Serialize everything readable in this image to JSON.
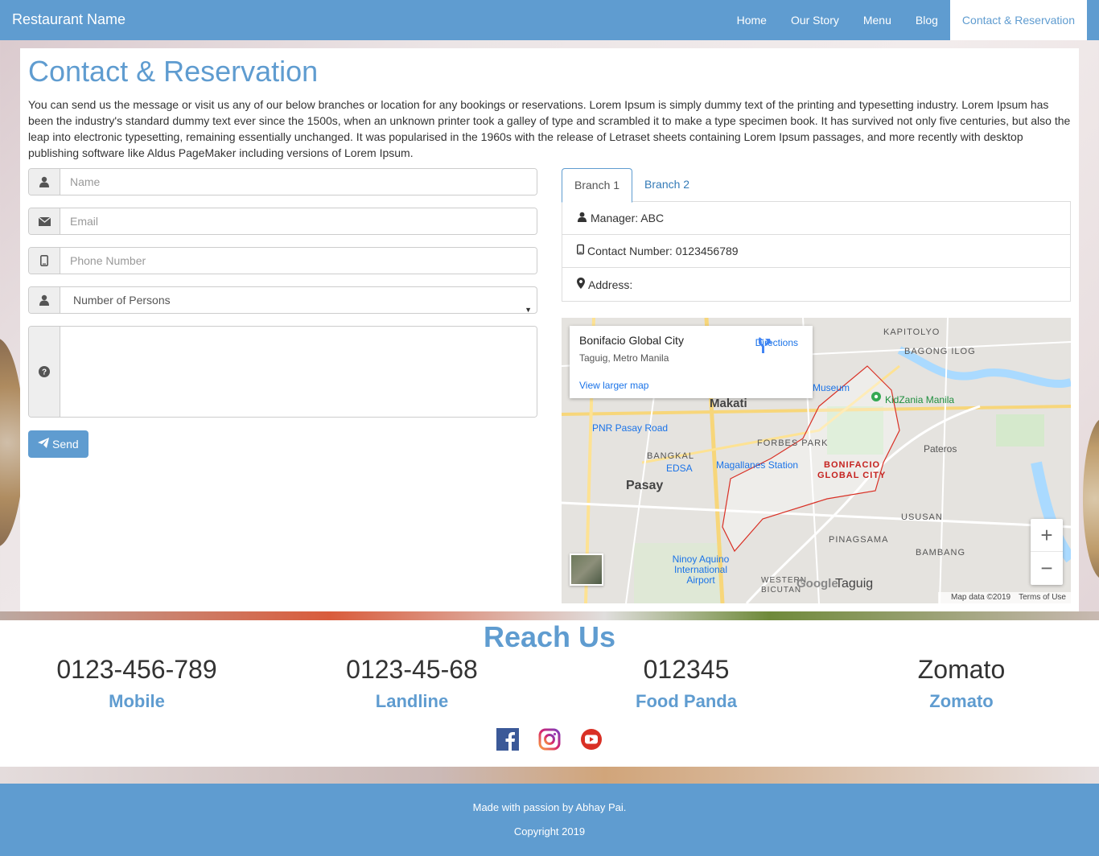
{
  "navbar": {
    "brand": "Restaurant Name",
    "items": [
      {
        "label": "Home"
      },
      {
        "label": "Our Story"
      },
      {
        "label": "Menu"
      },
      {
        "label": "Blog"
      },
      {
        "label": "Contact & Reservation",
        "active": true
      }
    ]
  },
  "contact": {
    "title": "Contact & Reservation",
    "intro": "You can send us the message or visit us any of our below branches or location for any bookings or reservations. Lorem Ipsum is simply dummy text of the printing and typesetting industry. Lorem Ipsum has been the industry's standard dummy text ever since the 1500s, when an unknown printer took a galley of type and scrambled it to make a type specimen book. It has survived not only five centuries, but also the leap into electronic typesetting, remaining essentially unchanged. It was popularised in the 1960s with the release of Letraset sheets containing Lorem Ipsum passages, and more recently with desktop publishing software like Aldus PageMaker including versions of Lorem Ipsum."
  },
  "form": {
    "name_placeholder": "Name",
    "email_placeholder": "Email",
    "phone_placeholder": "Phone Number",
    "persons_selected": "Number of Persons",
    "message_value": "",
    "send_label": "Send"
  },
  "branches": {
    "tabs": [
      {
        "label": "Branch 1",
        "active": true
      },
      {
        "label": "Branch 2"
      }
    ],
    "manager": "Manager: ABC",
    "contact": "Contact Number: 0123456789",
    "address": "Address:"
  },
  "map": {
    "place": "Bonifacio Global City",
    "subtitle": "Taguig, Metro Manila",
    "directions": "Directions",
    "larger_map": "View larger map",
    "attribution": "Map data ©2019",
    "terms": "Terms of Use",
    "labels": {
      "makati": "Makati",
      "pasay": "Pasay",
      "bgc": "BONIFACIO",
      "bgc2": "GLOBAL CITY",
      "kidzania": "KidZania Manila",
      "forbes": "FORBES PARK",
      "bangkal": "BANGKAL",
      "edsa": "EDSA",
      "magallanes": "Magallanes Station",
      "pnr": "PNR Pasay Road",
      "pateros": "Pateros",
      "ususan": "USUSAN",
      "pinagsama": "PINAGSAMA",
      "bambang": "BAMBANG",
      "taguig": "Taguig",
      "westbicutan": "WESTERN BICUTAN",
      "naia": "Ninoy Aquino International Airport",
      "kapitolyo": "KAPITOLYO",
      "bagongilog": "BAGONG ILOG",
      "museum": "Museum",
      "google": "Google"
    }
  },
  "reach": {
    "title": "Reach Us",
    "items": [
      {
        "value": "0123-456-789",
        "label": "Mobile"
      },
      {
        "value": "0123-45-68",
        "label": "Landline"
      },
      {
        "value": "012345",
        "label": "Food Panda"
      },
      {
        "value": "Zomato",
        "label": "Zomato"
      }
    ],
    "socials": [
      "facebook-icon",
      "instagram-icon",
      "youtube-icon"
    ]
  },
  "footer": {
    "credit": "Made with passion by Abhay Pai.",
    "copyright": "Copyright 2019"
  },
  "colors": {
    "primary": "#5f9cd0",
    "facebook": "#3b5998",
    "youtube": "#d93025"
  }
}
